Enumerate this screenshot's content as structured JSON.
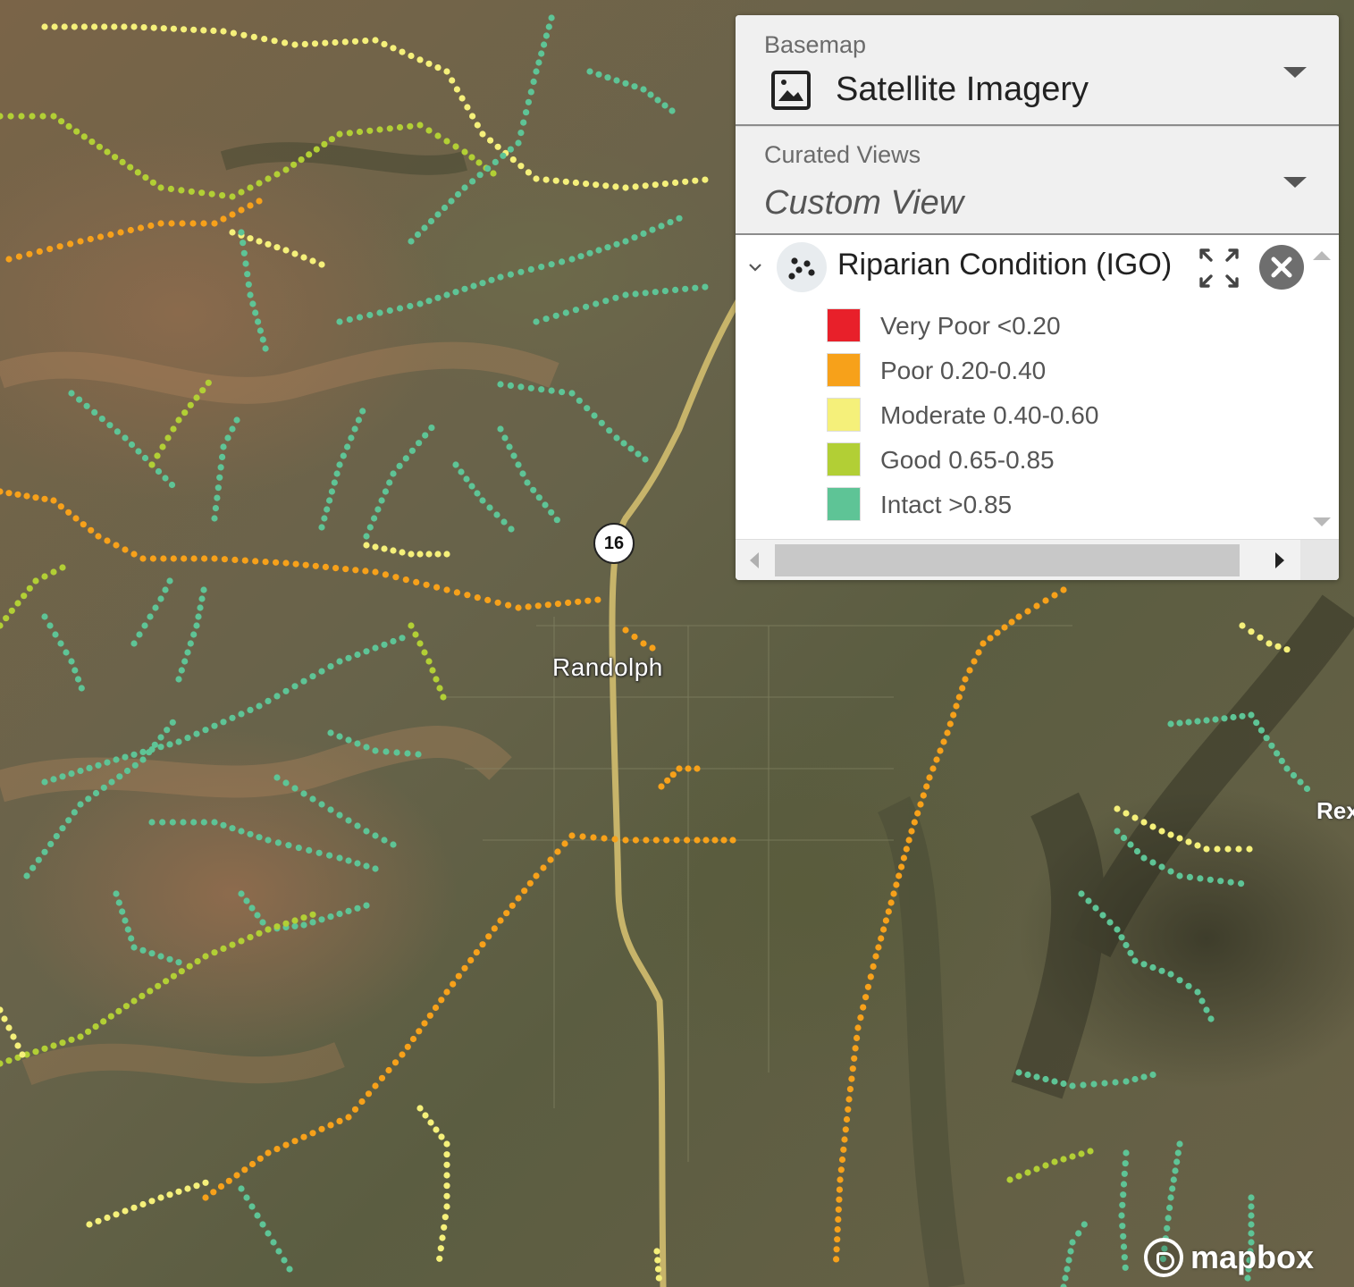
{
  "map": {
    "town_label": "Randolph",
    "town_label_partial": "Rex",
    "route_number": "16",
    "attribution": "mapbox",
    "condition_colors": {
      "very_poor": "#e8202a",
      "poor": "#f7a11a",
      "moderate": "#f5f07a",
      "good": "#b2cf35",
      "intact": "#5ec496"
    }
  },
  "basemap": {
    "label": "Basemap",
    "value": "Satellite Imagery",
    "icon": "image-icon"
  },
  "curated_views": {
    "label": "Curated Views",
    "value": "Custom View"
  },
  "layer": {
    "title": "Riparian Condition (IGO)",
    "icon": "point-cluster-icon",
    "legend": [
      {
        "label": "Very Poor <0.20",
        "color": "#e8202a"
      },
      {
        "label": "Poor 0.20-0.40",
        "color": "#f7a11a"
      },
      {
        "label": "Moderate 0.40-0.60",
        "color": "#f5f07a"
      },
      {
        "label": "Good 0.65-0.85",
        "color": "#b2cf35"
      },
      {
        "label": "Intact >0.85",
        "color": "#5ec496"
      }
    ]
  }
}
